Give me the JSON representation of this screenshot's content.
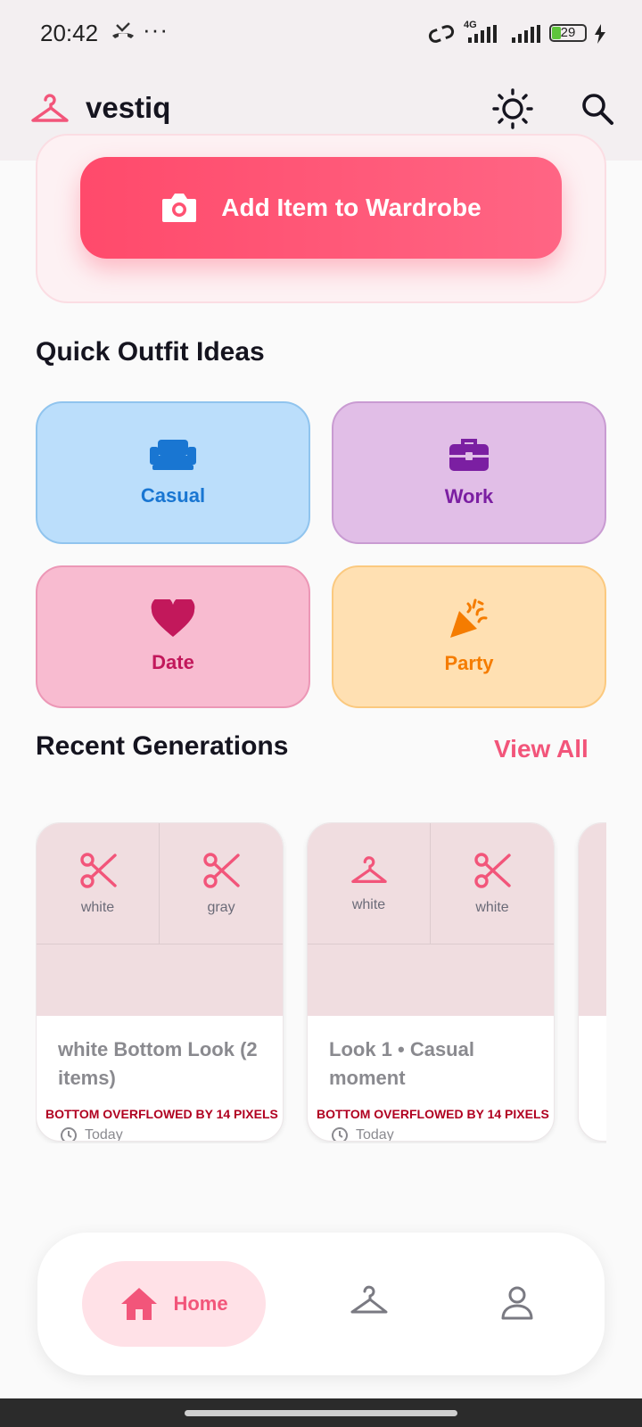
{
  "status_bar": {
    "time": "20:42",
    "network": "4G",
    "battery": "29"
  },
  "app_bar": {
    "title": "vestiq",
    "icons": [
      "hanger-logo-icon",
      "sun-icon",
      "search-icon"
    ]
  },
  "hero": {
    "add_button_label": "Add Item to Wardrobe",
    "icon": "camera-icon"
  },
  "quick_ideas": {
    "title": "Quick Outfit Ideas",
    "tiles": [
      {
        "label": "Casual",
        "icon": "sofa-icon",
        "color": "#1976d2",
        "bg": "#bbdefb"
      },
      {
        "label": "Work",
        "icon": "briefcase-icon",
        "color": "#7b1fa2",
        "bg": "#e1bee7"
      },
      {
        "label": "Date",
        "icon": "heart-icon",
        "color": "#c2185b",
        "bg": "#f8bbd0"
      },
      {
        "label": "Party",
        "icon": "party-popper-icon",
        "color": "#f57c00",
        "bg": "#ffe0b2"
      }
    ]
  },
  "recent": {
    "title": "Recent Generations",
    "view_all": "View All",
    "cards": [
      {
        "items": [
          {
            "icon": "scissors-icon",
            "label": "white"
          },
          {
            "icon": "scissors-icon",
            "label": "gray"
          }
        ],
        "title": "white Bottom Look (2 items)",
        "overflow": "BOTTOM OVERFLOWED BY 14 PIXELS",
        "date": "Today"
      },
      {
        "items": [
          {
            "icon": "hanger-icon",
            "label": "white"
          },
          {
            "icon": "scissors-icon",
            "label": "white"
          }
        ],
        "title": "Look 1 • Casual moment",
        "overflow": "BOTTOM OVERFLOWED BY 14 PIXELS",
        "date": "Today"
      }
    ]
  },
  "bottom_nav": {
    "home_label": "Home",
    "items": [
      "home-icon",
      "hanger-icon",
      "profile-icon"
    ]
  },
  "colors": {
    "accent": "#f2557a",
    "error": "#b00020"
  }
}
